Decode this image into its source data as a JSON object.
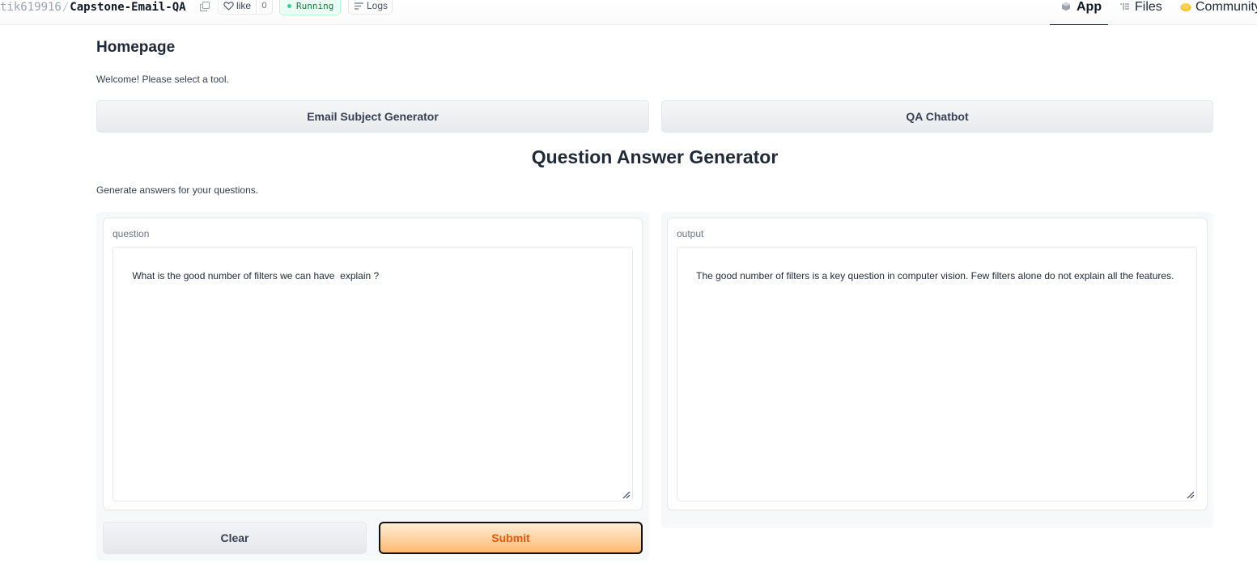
{
  "header": {
    "owner": "tik619916",
    "separator": "/",
    "space_name": "Capstone-Email-QA",
    "like_label": "like",
    "like_count": "0",
    "status": "Running",
    "logs_label": "Logs"
  },
  "nav": {
    "app": "App",
    "files": "Files",
    "community": "Community"
  },
  "homepage": {
    "title": "Homepage",
    "welcome": "Welcome! Please select a tool.",
    "tool_email": "Email Subject Generator",
    "tool_qa": "QA Chatbot"
  },
  "qa": {
    "title": "Question Answer Generator",
    "description": "Generate answers for your questions.",
    "question_label": "question",
    "question_value": "What is the good number of filters we can have  explain ?",
    "output_label": "output",
    "output_value": "The good number of filters is a key question in computer vision. Few filters alone do not explain all the features.",
    "clear_label": "Clear",
    "submit_label": "Submit"
  },
  "colors": {
    "status_green": "#15803d",
    "submit_text": "#ea580c",
    "submit_bg": "#fdba74"
  }
}
